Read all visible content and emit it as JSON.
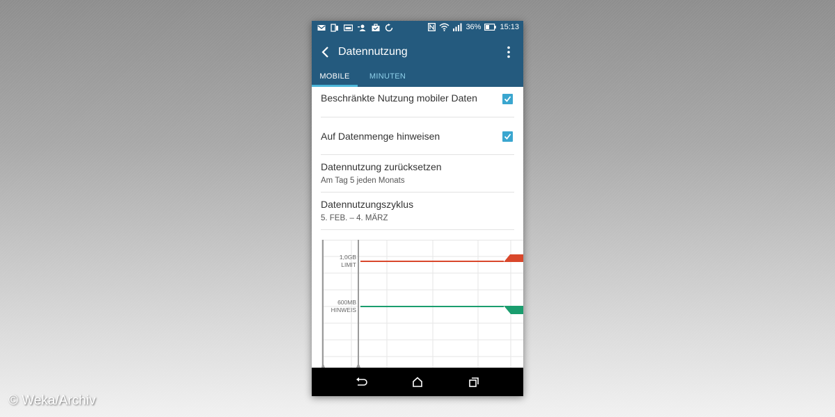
{
  "status_bar": {
    "battery": "36%",
    "time": "15:13",
    "left_icons": [
      "mail-icon",
      "phone-sync-icon",
      "screenshot-icon",
      "contacts-icon",
      "briefcase-icon",
      "sync-icon"
    ],
    "right_icons": [
      "nfc-icon",
      "wifi-icon",
      "signal-icon",
      "battery-icon"
    ]
  },
  "app_bar": {
    "title": "Datennutzung",
    "tabs": [
      {
        "label": "MOBILE",
        "active": true
      },
      {
        "label": "MINUTEN",
        "active": false
      }
    ]
  },
  "settings": [
    {
      "title": "Beschränkte Nutzung mobiler Daten",
      "checked": true
    },
    {
      "title": "Auf Datenmenge hinweisen",
      "checked": true
    },
    {
      "title": "Datennutzung zurücksetzen",
      "subtitle": "Am Tag 5 jeden Monats"
    },
    {
      "title": "Datennutzungszyklus",
      "subtitle": "5. FEB. – 4. MÄRZ"
    }
  ],
  "chart": {
    "limit": {
      "line1": "1,0GB",
      "line2": "LIMIT",
      "color": "#d9472b"
    },
    "warning": {
      "line1": "600MB",
      "line2": "HINWEIS",
      "color": "#1a9d6e"
    }
  },
  "watermark": "© Weka/Archiv",
  "colors": {
    "accent": "#245a7e",
    "tab_indicator": "#4cb6d9",
    "checkbox": "#3aa6cf"
  }
}
